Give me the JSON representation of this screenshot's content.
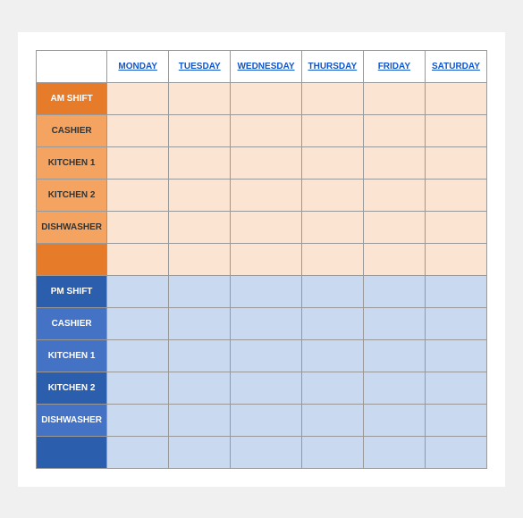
{
  "header": {
    "empty_label": "",
    "columns": [
      "MONDAY",
      "TUESDAY",
      "WEDNESDAY",
      "THURSDAY",
      "FRIDAY",
      "SATURDAY"
    ]
  },
  "am_rows": [
    {
      "label": "AM SHIFT",
      "type": "shift"
    },
    {
      "label": "CASHIER",
      "type": "label"
    },
    {
      "label": "KITCHEN 1",
      "type": "label"
    },
    {
      "label": "KITCHEN 2",
      "type": "label"
    },
    {
      "label": "DISHWASHER",
      "type": "label"
    },
    {
      "label": "",
      "type": "extra"
    }
  ],
  "pm_rows": [
    {
      "label": "PM SHIFT",
      "type": "shift"
    },
    {
      "label": "CASHIER",
      "type": "label"
    },
    {
      "label": "KITCHEN 1",
      "type": "label"
    },
    {
      "label": "KITCHEN 2",
      "type": "shift"
    },
    {
      "label": "DISHWASHER",
      "type": "label"
    },
    {
      "label": "",
      "type": "extra"
    }
  ]
}
